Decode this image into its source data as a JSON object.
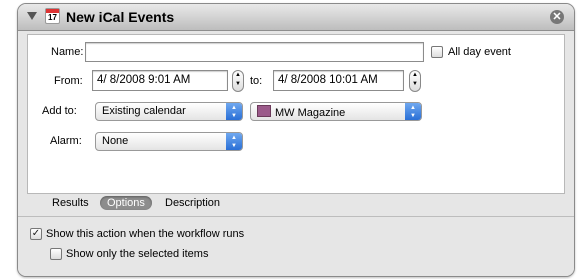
{
  "action": {
    "title": "New iCal Events",
    "calendar_icon_day": "17",
    "close_glyph": "✕"
  },
  "form": {
    "name_label": "Name:",
    "name_value": "",
    "all_day_label": "All day event",
    "all_day_checked": false,
    "from_label": "From:",
    "from_value": "4/  8/2008   9:01 AM",
    "to_label": "to:",
    "to_value": "4/  8/2008  10:01 AM",
    "add_to_label": "Add to:",
    "add_to_option": "Existing calendar",
    "calendar_option": "MW Magazine",
    "calendar_color": "#9b5a8a",
    "alarm_label": "Alarm:",
    "alarm_option": "None"
  },
  "tabs": [
    {
      "label": "Results",
      "active": false
    },
    {
      "label": "Options",
      "active": true
    },
    {
      "label": "Description",
      "active": false
    }
  ],
  "options": {
    "show_action_label": "Show this action when the workflow runs",
    "show_action_checked": true,
    "show_selected_label": "Show only the selected items",
    "show_selected_checked": false
  }
}
